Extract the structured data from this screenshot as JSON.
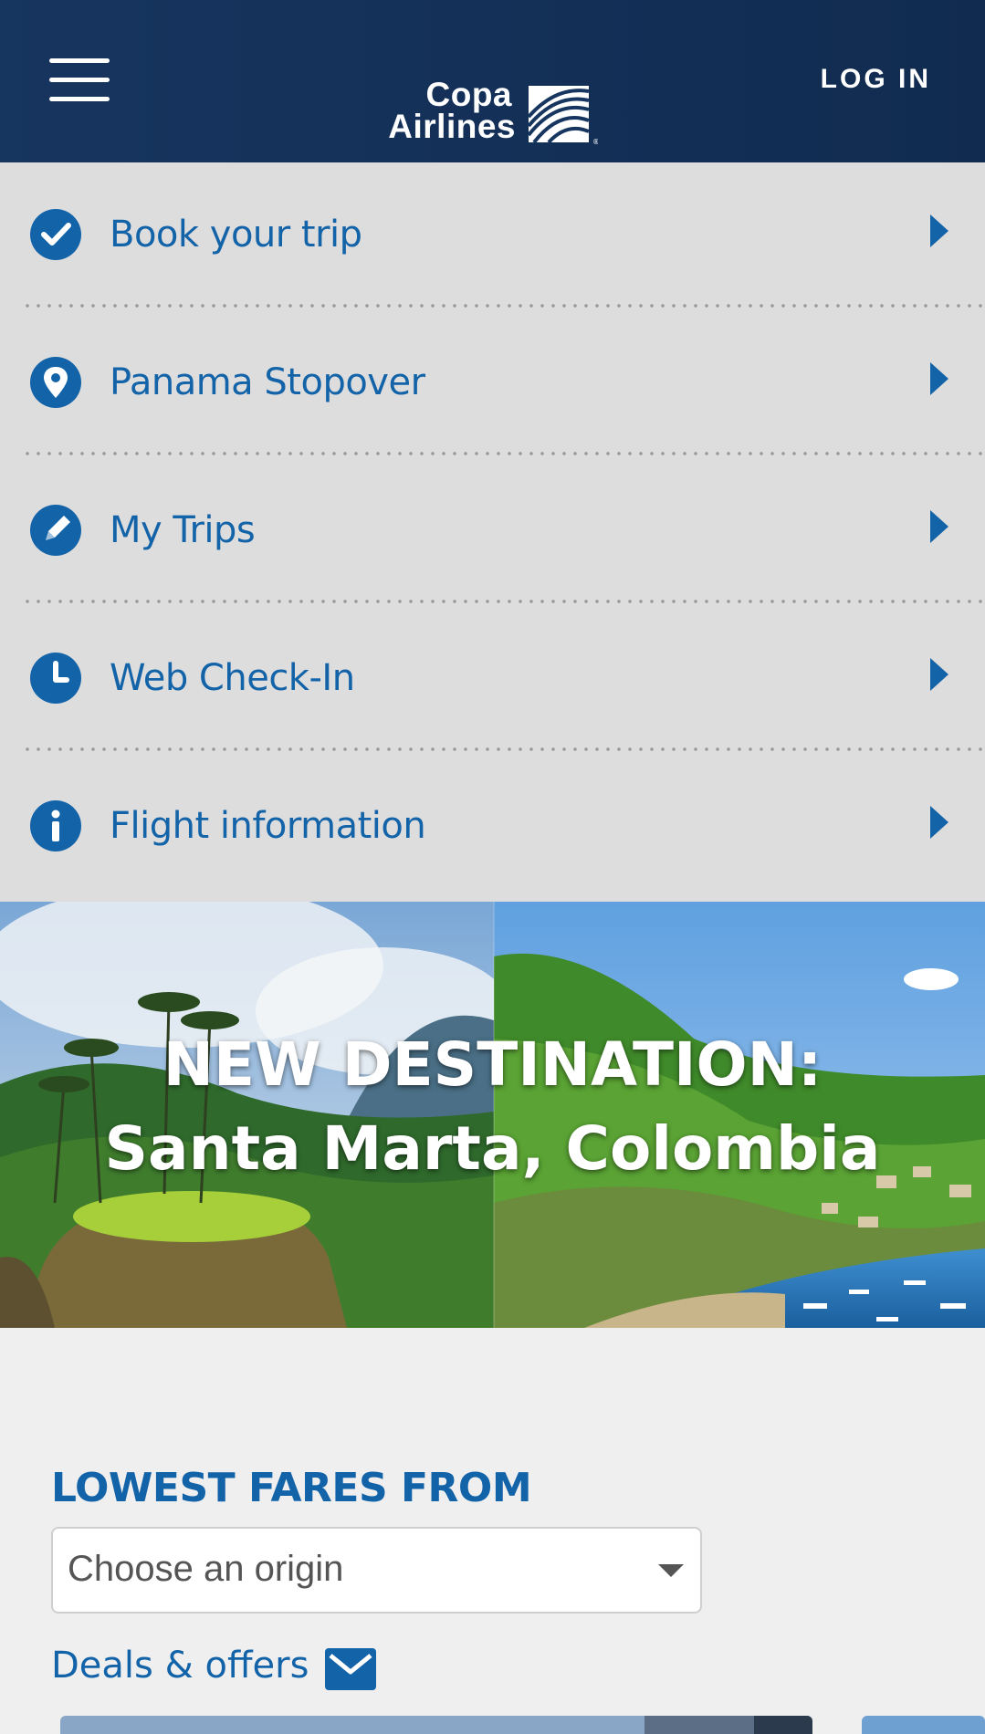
{
  "header": {
    "menu_icon": "hamburger-icon",
    "logo": {
      "line1": "Copa",
      "line2": "Airlines",
      "registered": "®"
    },
    "login_label": "LOG IN"
  },
  "menu": {
    "items": [
      {
        "label": "Book your trip",
        "icon": "checkmark-circle-icon"
      },
      {
        "label": "Panama Stopover",
        "icon": "location-pin-icon"
      },
      {
        "label": "My Trips",
        "icon": "pencil-circle-icon"
      },
      {
        "label": "Web Check-In",
        "icon": "clock-icon"
      },
      {
        "label": "Flight information",
        "icon": "info-icon"
      }
    ],
    "arrow_icon": "chevron-right-icon"
  },
  "banner": {
    "line1": "NEW DESTINATION:",
    "line2": "Santa Marta, Colombia"
  },
  "fares": {
    "title": "LOWEST FARES FROM",
    "origin_placeholder": "Choose an origin",
    "deals_label": "Deals & offers",
    "deals_icon": "envelope-icon"
  },
  "colors": {
    "header_bg": "#16355f",
    "brand_blue": "#1363a9",
    "menu_bg": "#dedddd",
    "page_bg": "#efefef"
  }
}
